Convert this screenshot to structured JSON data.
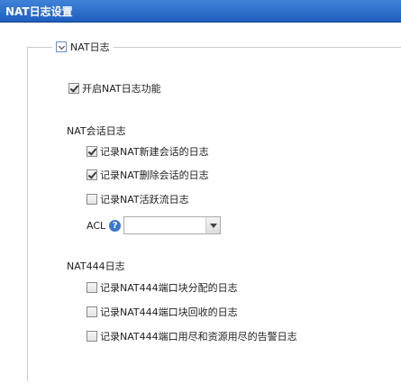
{
  "window": {
    "title": "NAT日志设置"
  },
  "group": {
    "legend": "NAT日志"
  },
  "enable": {
    "label": "开启NAT日志功能",
    "checked": true
  },
  "session": {
    "heading": "NAT会话日志",
    "items": [
      {
        "label": "记录NAT新建会话的日志",
        "checked": true
      },
      {
        "label": "记录NAT删除会话的日志",
        "checked": true
      },
      {
        "label": "记录NAT活跃流日志",
        "checked": false
      }
    ],
    "acl": {
      "label": "ACL",
      "help_icon": "?",
      "value": ""
    }
  },
  "nat444": {
    "heading": "NAT444日志",
    "items": [
      {
        "label": "记录NAT444端口块分配的日志",
        "checked": false
      },
      {
        "label": "记录NAT444端口块回收的日志",
        "checked": false
      },
      {
        "label": "记录NAT444端口用尽和资源用尽的告警日志",
        "checked": false
      }
    ]
  },
  "colors": {
    "titlebar": "#2a6ccb",
    "border": "#c9c9c9",
    "help": "#3a78c9"
  }
}
